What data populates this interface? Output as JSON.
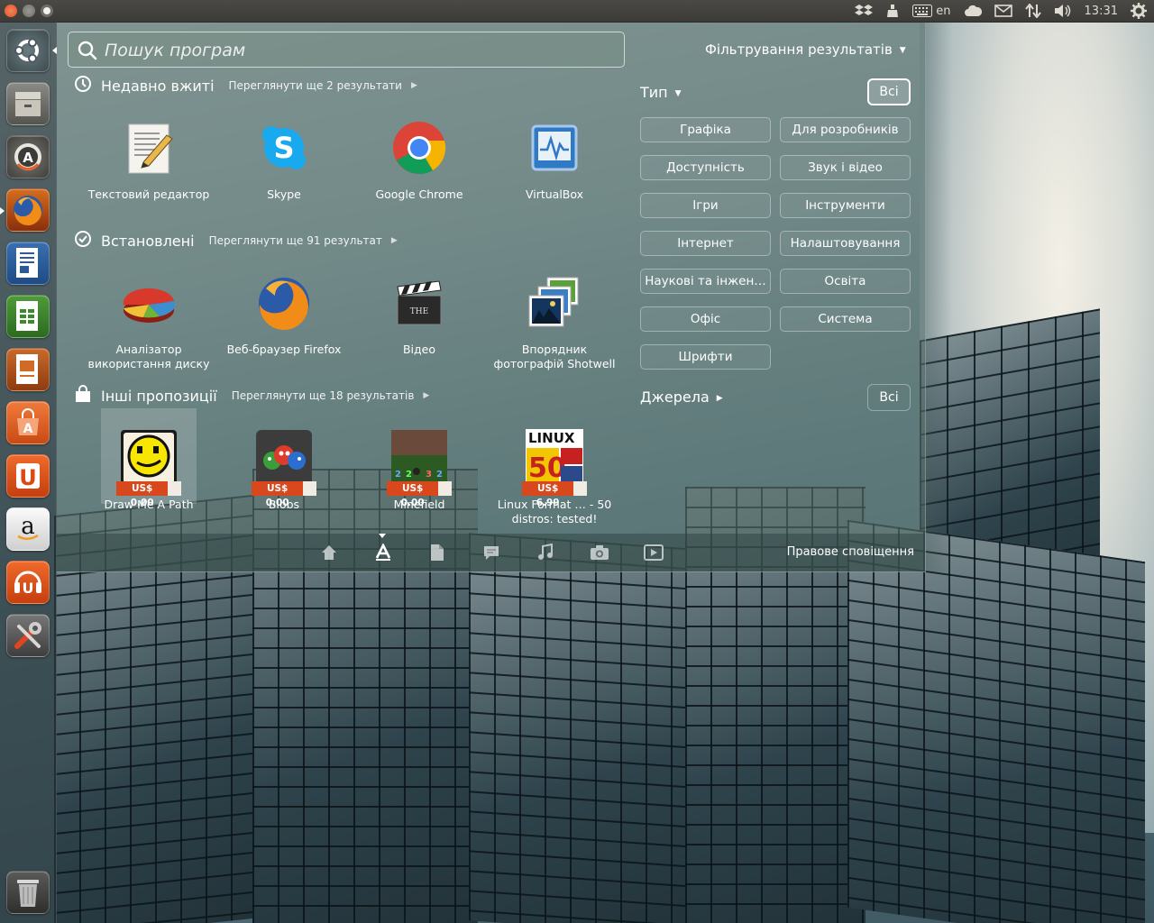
{
  "top_panel": {
    "keyboard_layout": "en",
    "clock": "13:31",
    "indicators": [
      "dropbox-icon",
      "usb-drive-icon",
      "keyboard-icon",
      "cloud-icon",
      "mail-icon",
      "network-icon",
      "volume-icon",
      "settings-gear-icon"
    ]
  },
  "launcher": {
    "items": [
      "ubuntu-logo-icon",
      "file-manager-icon",
      "update-manager-icon",
      "firefox-icon",
      "writer-icon",
      "calc-icon",
      "impress-icon",
      "software-center-icon",
      "ubuntu-one-icon",
      "amazon-icon",
      "ubuntu-one-music-icon",
      "system-settings-icon",
      "trash-icon"
    ]
  },
  "search": {
    "placeholder": "Пошук програм"
  },
  "categories": [
    {
      "title": "Недавно вжиті",
      "more": "Переглянути ще 2 результати",
      "items": [
        {
          "label": "Текстовий редактор"
        },
        {
          "label": "Skype"
        },
        {
          "label": "Google Chrome"
        },
        {
          "label": "VirtualBox"
        }
      ]
    },
    {
      "title": "Встановлені",
      "more": "Переглянути ще 91 результат",
      "items": [
        {
          "label": "Аналізатор використання диску"
        },
        {
          "label": "Веб-браузер Firefox"
        },
        {
          "label": "Відео"
        },
        {
          "label": "Впорядник фотографій Shotwell"
        }
      ]
    },
    {
      "title": "Інші пропозиції",
      "more": "Переглянути ще 18 результатів",
      "items": [
        {
          "label": "Draw Me A Path",
          "price": "US$ 0.00"
        },
        {
          "label": "Blobs",
          "price": "US$ 0.00"
        },
        {
          "label": "Minefield",
          "price": "US$ 0.00"
        },
        {
          "label": "Linux Format … - 50 distros: tested!",
          "price": "US$ 6.99"
        }
      ]
    }
  ],
  "filters": {
    "title": "Фільтрування результатів",
    "type_heading": "Тип",
    "all_label": "Всі",
    "type_buttons": [
      "Графіка",
      "Для розробників",
      "Доступність",
      "Звук і відео",
      "Ігри",
      "Інструменти",
      "Інтернет",
      "Налаштовування",
      "Наукові та інжен…",
      "Освіта",
      "Офіс",
      "Система",
      "Шрифти"
    ],
    "sources_heading": "Джерела",
    "sources_all_label": "Всі"
  },
  "lens_bar": {
    "lenses": [
      "home-icon",
      "applications-icon",
      "files-icon",
      "social-icon",
      "music-icon",
      "photos-icon",
      "video-icon"
    ],
    "active": "applications-icon",
    "notification": "Правове сповіщення"
  }
}
